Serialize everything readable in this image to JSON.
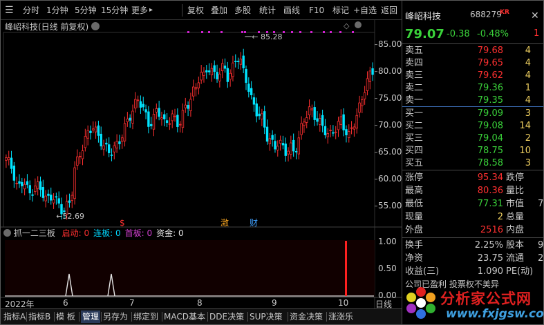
{
  "toolbar": {
    "items": [
      "分时",
      "1分钟",
      "5分钟",
      "15分钟",
      "更多",
      "复权",
      "叠加",
      "多股",
      "统计",
      "画线",
      "F10",
      "标记",
      "+自选",
      "返回"
    ],
    "more_arrow": "▸"
  },
  "chart": {
    "header": "峰岹科技(日线 前复权)",
    "high_mark": "85.28",
    "low_mark": "52.69",
    "y_ticks": [
      "85.00",
      "80.00",
      "75.00",
      "70.00",
      "65.00",
      "60.00",
      "55.00"
    ],
    "event_marks": [
      "$",
      "激",
      "财"
    ],
    "colors": {
      "up": "#ff3030",
      "down": "#00e4ff",
      "dot": "#d020d0"
    }
  },
  "indicator": {
    "name": "抓一二三板",
    "fields": [
      {
        "label": "启动:",
        "value": "0",
        "color": "#ff3030"
      },
      {
        "label": "连板:",
        "value": "0",
        "color": "#00d8ff"
      },
      {
        "label": "首板:",
        "value": "0",
        "color": "#d040d0"
      },
      {
        "label": "资金:",
        "value": "0",
        "color": "#e6e6e6"
      }
    ],
    "y_ticks": [
      "1.00",
      "0.50",
      "0.00"
    ]
  },
  "date_axis": {
    "labels": [
      "2022年",
      "6",
      "7",
      "8",
      "9",
      "10"
    ],
    "mode": "日线"
  },
  "tabs": [
    "指标A",
    "指标B",
    "模 板",
    "管理",
    "另存为",
    "绑定到",
    "MACD基本",
    "DDE决策",
    "SUP决策",
    "资金决策",
    "涨涨乐"
  ],
  "active_tab": "管理",
  "quote": {
    "name": "峰岹科技",
    "code": "688279",
    "badge": "KR",
    "price": "79.07",
    "change": "-0.38",
    "change_pct": "-0.48%",
    "edge_digit": "1",
    "asks": [
      {
        "label": "卖五",
        "price": "79.68",
        "vol": "4",
        "color": "#ff3030"
      },
      {
        "label": "卖四",
        "price": "79.65",
        "vol": "4",
        "color": "#ff3030"
      },
      {
        "label": "卖三",
        "price": "79.62",
        "vol": "4",
        "color": "#ff3030"
      },
      {
        "label": "卖二",
        "price": "79.36",
        "vol": "1",
        "color": "#3ad23a"
      },
      {
        "label": "卖一",
        "price": "79.35",
        "vol": "4",
        "color": "#3ad23a"
      }
    ],
    "bids": [
      {
        "label": "买一",
        "price": "79.09",
        "vol": "3",
        "color": "#3ad23a"
      },
      {
        "label": "买二",
        "price": "79.08",
        "vol": "14",
        "color": "#3ad23a"
      },
      {
        "label": "买三",
        "price": "79.04",
        "vol": "2",
        "color": "#3ad23a"
      },
      {
        "label": "买四",
        "price": "78.75",
        "vol": "10",
        "color": "#3ad23a"
      },
      {
        "label": "买五",
        "price": "78.58",
        "vol": "3",
        "color": "#3ad23a"
      }
    ],
    "stats": [
      {
        "l1": "涨停",
        "v1": "95.34",
        "c1": "#ff3030",
        "l2": "跌停",
        "v2": ""
      },
      {
        "l1": "最高",
        "v1": "80.36",
        "c1": "#ff3030",
        "l2": "量比",
        "v2": ""
      },
      {
        "l1": "最低",
        "v1": "77.31",
        "c1": "#3ad23a",
        "l2": "市值",
        "v2": "7"
      },
      {
        "l1": "现量",
        "v1": "2",
        "c1": "#f0d060",
        "l2": "总量",
        "v2": ""
      },
      {
        "l1": "外盘",
        "v1": "2516",
        "c1": "#ff3030",
        "l2": "内盘",
        "v2": ""
      }
    ],
    "stats2": [
      {
        "l1": "换手",
        "v1": "2.25%",
        "c1": "#c8c8c8",
        "l2": "股本",
        "v2": "9"
      },
      {
        "l1": "净资",
        "v1": "23.75",
        "c1": "#c8c8c8",
        "l2": "流通",
        "v2": "2"
      },
      {
        "l1": "收益(三)",
        "v1": "1.090",
        "c1": "#c8c8c8",
        "l2": "PE(动)",
        "v2": ""
      }
    ],
    "partial_text": "公司已盈利 投票权不美异"
  },
  "watermark": {
    "title": "分析家公式网",
    "url": "www.fxjgsw.com"
  }
}
